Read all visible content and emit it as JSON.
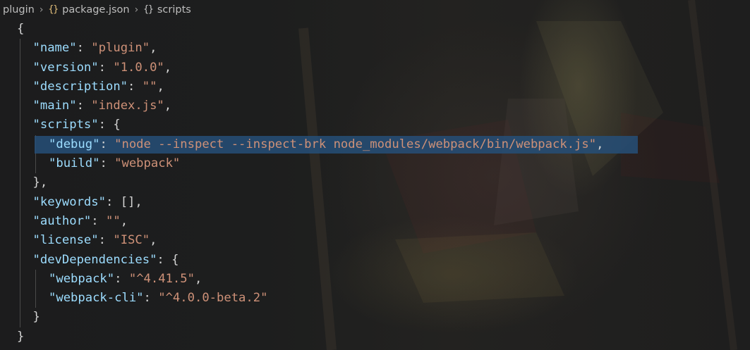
{
  "breadcrumb": {
    "folder": "plugin",
    "file": "package.json",
    "symbol": "scripts",
    "file_icon": "{}",
    "symbol_icon": "{}"
  },
  "editor": {
    "colors": {
      "key": "#9cdcfe",
      "string": "#ce9178",
      "punctuation": "#d4d4d4",
      "selection": "#264f78",
      "json_icon": "#e5c07b"
    },
    "lines": [
      {
        "indent": 1,
        "pre": "{",
        "key": "",
        "sep": "",
        "val": "",
        "post": ""
      },
      {
        "indent": 2,
        "pre": "",
        "key": "\"name\"",
        "sep": ": ",
        "val": "\"plugin\"",
        "post": ","
      },
      {
        "indent": 2,
        "pre": "",
        "key": "\"version\"",
        "sep": ": ",
        "val": "\"1.0.0\"",
        "post": ","
      },
      {
        "indent": 2,
        "pre": "",
        "key": "\"description\"",
        "sep": ": ",
        "val": "\"\"",
        "post": ","
      },
      {
        "indent": 2,
        "pre": "",
        "key": "\"main\"",
        "sep": ": ",
        "val": "\"index.js\"",
        "post": ","
      },
      {
        "indent": 2,
        "pre": "",
        "key": "\"scripts\"",
        "sep": ": ",
        "val": "",
        "post": "{"
      },
      {
        "indent": 3,
        "pre": "",
        "key": "\"debug\"",
        "sep": ": ",
        "val": "\"node --inspect --inspect-brk node_modules/webpack/bin/webpack.js\"",
        "post": ",",
        "selected": true
      },
      {
        "indent": 3,
        "pre": "",
        "key": "\"build\"",
        "sep": ": ",
        "val": "\"webpack\"",
        "post": ""
      },
      {
        "indent": 2,
        "pre": "},",
        "key": "",
        "sep": "",
        "val": "",
        "post": ""
      },
      {
        "indent": 2,
        "pre": "",
        "key": "\"keywords\"",
        "sep": ": ",
        "val": "",
        "post": "[],"
      },
      {
        "indent": 2,
        "pre": "",
        "key": "\"author\"",
        "sep": ": ",
        "val": "\"\"",
        "post": ","
      },
      {
        "indent": 2,
        "pre": "",
        "key": "\"license\"",
        "sep": ": ",
        "val": "\"ISC\"",
        "post": ","
      },
      {
        "indent": 2,
        "pre": "",
        "key": "\"devDependencies\"",
        "sep": ": ",
        "val": "",
        "post": "{"
      },
      {
        "indent": 3,
        "pre": "",
        "key": "\"webpack\"",
        "sep": ": ",
        "val": "\"^4.41.5\"",
        "post": ","
      },
      {
        "indent": 3,
        "pre": "",
        "key": "\"webpack-cli\"",
        "sep": ": ",
        "val": "\"^4.0.0-beta.2\"",
        "post": ""
      },
      {
        "indent": 2,
        "pre": "}",
        "key": "",
        "sep": "",
        "val": "",
        "post": ""
      },
      {
        "indent": 1,
        "pre": "}",
        "key": "",
        "sep": "",
        "val": "",
        "post": ""
      }
    ]
  }
}
